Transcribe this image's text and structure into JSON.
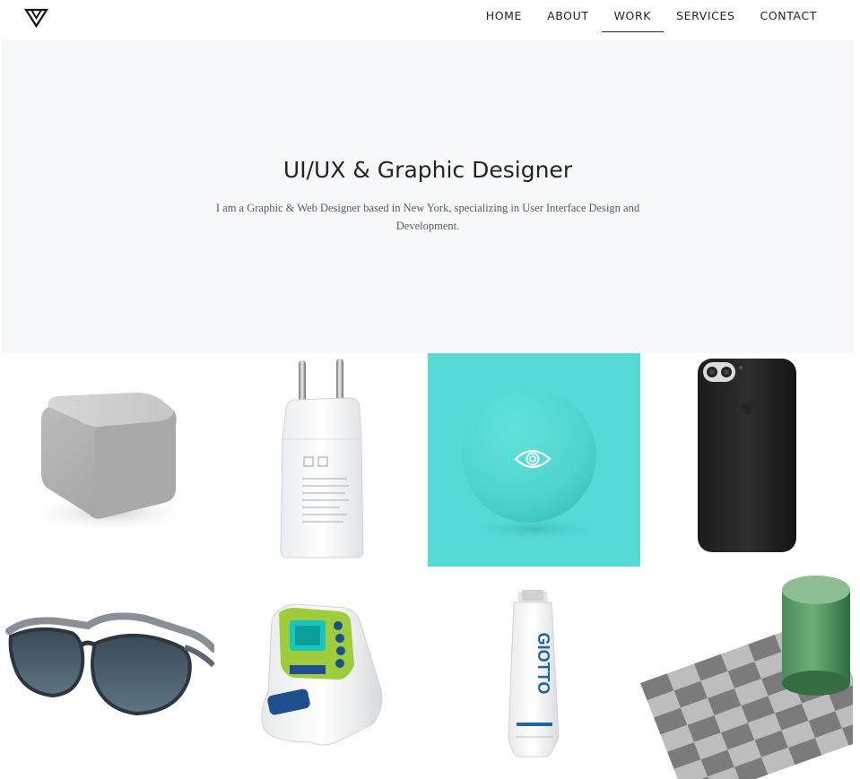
{
  "header": {
    "logo_icon": "triangle-logo-icon",
    "nav": [
      {
        "label": "HOME",
        "active": false
      },
      {
        "label": "ABOUT",
        "active": false
      },
      {
        "label": "WORK",
        "active": true
      },
      {
        "label": "SERVICES",
        "active": false
      },
      {
        "label": "CONTACT",
        "active": false
      }
    ]
  },
  "hero": {
    "title": "UI/UX & Graphic Designer",
    "description": "I am a Graphic & Web Designer based in New York, specializing in User Interface Design and Development.",
    "background": "#f7f8f9"
  },
  "gallery": {
    "items": [
      {
        "subject": "grey rounded cube"
      },
      {
        "subject": "white wall charger"
      },
      {
        "subject": "teal sphere",
        "hover_icon": "eye-icon",
        "overlay_color": "#56dad5"
      },
      {
        "subject": "black phone case"
      },
      {
        "subject": "sport sunglasses"
      },
      {
        "subject": "handheld device"
      },
      {
        "subject": "paint tube",
        "label": "GIOTTO"
      },
      {
        "subject": "checkerboard with green cylinder"
      }
    ]
  }
}
